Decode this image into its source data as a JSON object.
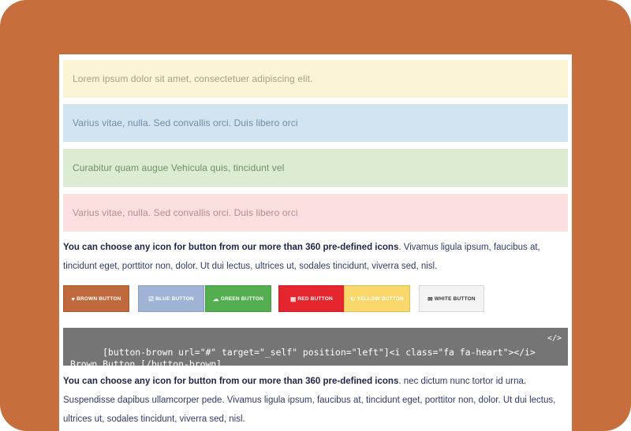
{
  "alerts": [
    {
      "text": "Lorem ipsum dolor sit amet, consectetuer adipiscing elit."
    },
    {
      "text": "Varius vitae, nulla. Sed convallis orci. Duis libero orci"
    },
    {
      "text": "Curabitur quam augue Vehicula quis, tincidunt vel"
    },
    {
      "text": "Varius vitae, nulla. Sed convallis orci. Duis libero orci"
    }
  ],
  "paragraph1": {
    "bold": "You can choose any icon for button from our more than 360 pre-defined icons",
    "rest": ". Vivamus ligula ipsum, faucibus at, tincidunt eget, porttitor non, dolor. Ut dui lectus, ultrices ut, sodales tincidunt, viverra sed, nisl."
  },
  "buttons": [
    {
      "label": "BROWN BUTTON",
      "icon": "heart-icon",
      "glyph": "♥"
    },
    {
      "label": "BLUE BUTTON",
      "icon": "check-square-icon",
      "glyph": "☑"
    },
    {
      "label": "GREEN BUTTON",
      "icon": "cloud-download-icon",
      "glyph": "☁"
    },
    {
      "label": "RED BUTTON",
      "icon": "news-icon",
      "glyph": "▤"
    },
    {
      "label": "YELLOW BUTTON",
      "icon": "refresh-icon",
      "glyph": "↻"
    },
    {
      "label": "WHITE BUTTON",
      "icon": "envelope-icon",
      "glyph": "✉"
    }
  ],
  "code_block": {
    "code": "[button-brown url=\"#\" target=\"_self\" position=\"left\"]<i class=\"fa fa-heart\"></i>\nBrown Button [/button-brown]",
    "icon": "code-icon",
    "glyph": "</>"
  },
  "paragraph2": {
    "bold": "You can choose any icon for button from our more than 360 pre-defined icons",
    "rest": ". nec dictum nunc tortor id urna. Suspendisse dapibus ullamcorper pede. Vivamus ligula ipsum, faucibus at, tincidunt eget, porttitor non, dolor. Ut dui lectus, ultrices ut, sodales tincidunt, viverra sed, nisl."
  },
  "colors": {
    "frame": "#c66e3c",
    "brown": "#c0693c",
    "blue": "#9fb3d4",
    "green": "#52ae4e",
    "red": "#e6262f",
    "yellow": "#f8d86a",
    "white": "#f4f4f4",
    "code_bg": "#757575"
  }
}
